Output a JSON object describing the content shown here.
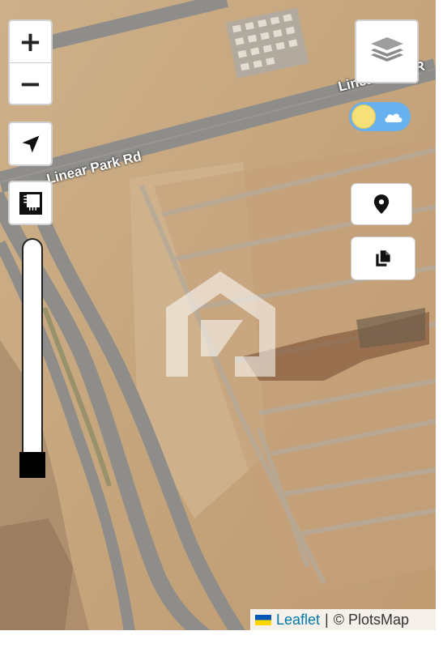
{
  "map": {
    "road_labels": {
      "main": "Linear Park Rd",
      "upper": "Linear Park R"
    },
    "watermark_icon": "plotsmap-logo-icon"
  },
  "controls": {
    "zoom_in_label": "+",
    "zoom_out_label": "−",
    "locate_icon": "navigation-arrow-icon",
    "ruler_icon": "ruler-icon",
    "layers_icon": "layers-icon",
    "day_toggle_icon": "sun-cloud-icon",
    "pin_icon": "map-pin-icon",
    "copy_icon": "copy-icon",
    "slider_level": 0.0
  },
  "attribution": {
    "leaflet": "Leaflet",
    "separator": "|",
    "copyright": "© PlotsMap"
  },
  "colors": {
    "terrain": "#c8a982",
    "road": "#8f8d8a",
    "slider_thumb": "#000000",
    "toggle_bg": "#67b1ef",
    "sun": "#f6e07a",
    "leaflet_link": "#0078a8"
  }
}
